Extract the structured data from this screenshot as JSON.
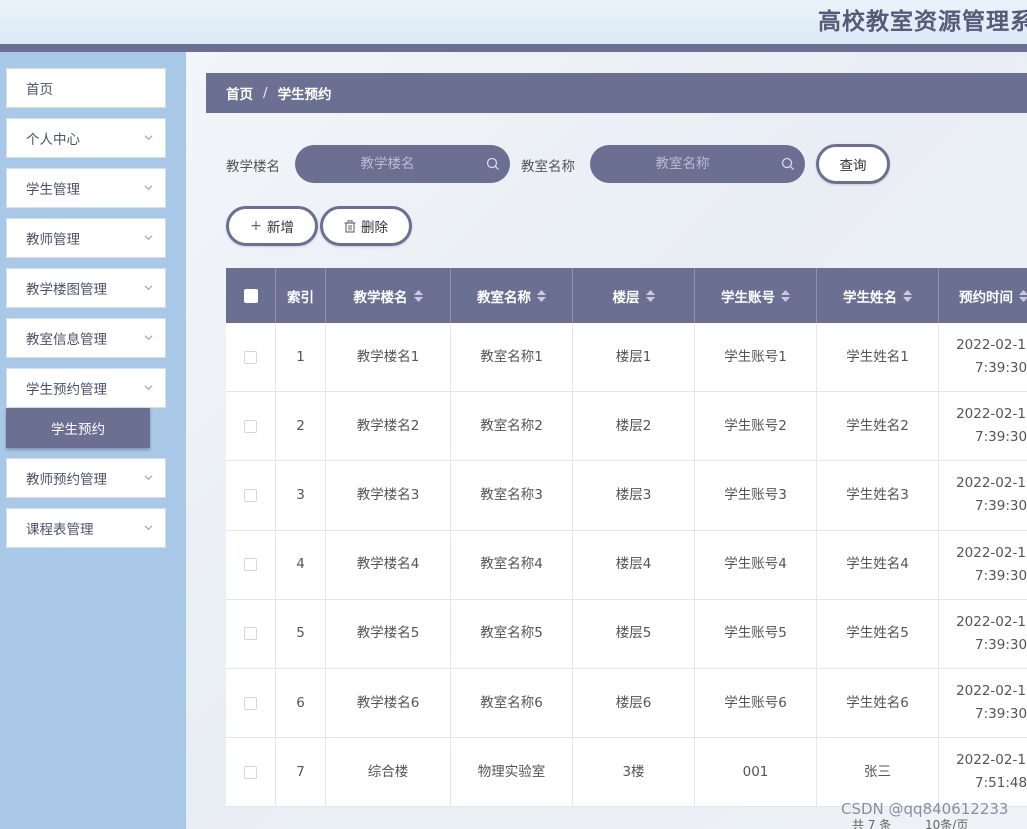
{
  "header": {
    "title": "高校教室资源管理系"
  },
  "sidebar": {
    "items": [
      {
        "label": "首页",
        "has_arrow": false
      },
      {
        "label": "个人中心",
        "has_arrow": true
      },
      {
        "label": "学生管理",
        "has_arrow": true
      },
      {
        "label": "教师管理",
        "has_arrow": true
      },
      {
        "label": "教学楼图管理",
        "has_arrow": true
      },
      {
        "label": "教室信息管理",
        "has_arrow": true
      },
      {
        "label": "学生预约管理",
        "has_arrow": true
      },
      {
        "label": "教师预约管理",
        "has_arrow": true
      },
      {
        "label": "课程表管理",
        "has_arrow": true
      }
    ],
    "active_subitem": "学生预约"
  },
  "breadcrumb": {
    "home": "首页",
    "separator": "/",
    "current": "学生预约"
  },
  "search": {
    "building_label": "教学楼名",
    "building_placeholder": "教学楼名",
    "classroom_label": "教室名称",
    "classroom_placeholder": "教室名称",
    "query_button": "查询"
  },
  "actions": {
    "add": "新增",
    "delete": "删除"
  },
  "table": {
    "columns": [
      "索引",
      "教学楼名",
      "教室名称",
      "楼层",
      "学生账号",
      "学生姓名",
      "预约时间"
    ],
    "rows": [
      {
        "index": "1",
        "building": "教学楼名1",
        "classroom": "教室名称1",
        "floor": "楼层1",
        "account": "学生账号1",
        "name": "学生姓名1",
        "time_date": "2022-02-1",
        "time_clock": "7:39:30"
      },
      {
        "index": "2",
        "building": "教学楼名2",
        "classroom": "教室名称2",
        "floor": "楼层2",
        "account": "学生账号2",
        "name": "学生姓名2",
        "time_date": "2022-02-1",
        "time_clock": "7:39:30"
      },
      {
        "index": "3",
        "building": "教学楼名3",
        "classroom": "教室名称3",
        "floor": "楼层3",
        "account": "学生账号3",
        "name": "学生姓名3",
        "time_date": "2022-02-1",
        "time_clock": "7:39:30"
      },
      {
        "index": "4",
        "building": "教学楼名4",
        "classroom": "教室名称4",
        "floor": "楼层4",
        "account": "学生账号4",
        "name": "学生姓名4",
        "time_date": "2022-02-1",
        "time_clock": "7:39:30"
      },
      {
        "index": "5",
        "building": "教学楼名5",
        "classroom": "教室名称5",
        "floor": "楼层5",
        "account": "学生账号5",
        "name": "学生姓名5",
        "time_date": "2022-02-1",
        "time_clock": "7:39:30"
      },
      {
        "index": "6",
        "building": "教学楼名6",
        "classroom": "教室名称6",
        "floor": "楼层6",
        "account": "学生账号6",
        "name": "学生姓名6",
        "time_date": "2022-02-1",
        "time_clock": "7:39:30"
      },
      {
        "index": "7",
        "building": "综合楼",
        "classroom": "物理实验室",
        "floor": "3楼",
        "account": "001",
        "name": "张三",
        "time_date": "2022-02-1",
        "time_clock": "7:51:48"
      }
    ]
  },
  "pager": {
    "total": "共 7 条",
    "size": "10条/页"
  },
  "watermark": "CSDN @qq840612233",
  "colors": {
    "accent": "#6b6f92",
    "sidebar": "#a9c8e8"
  }
}
